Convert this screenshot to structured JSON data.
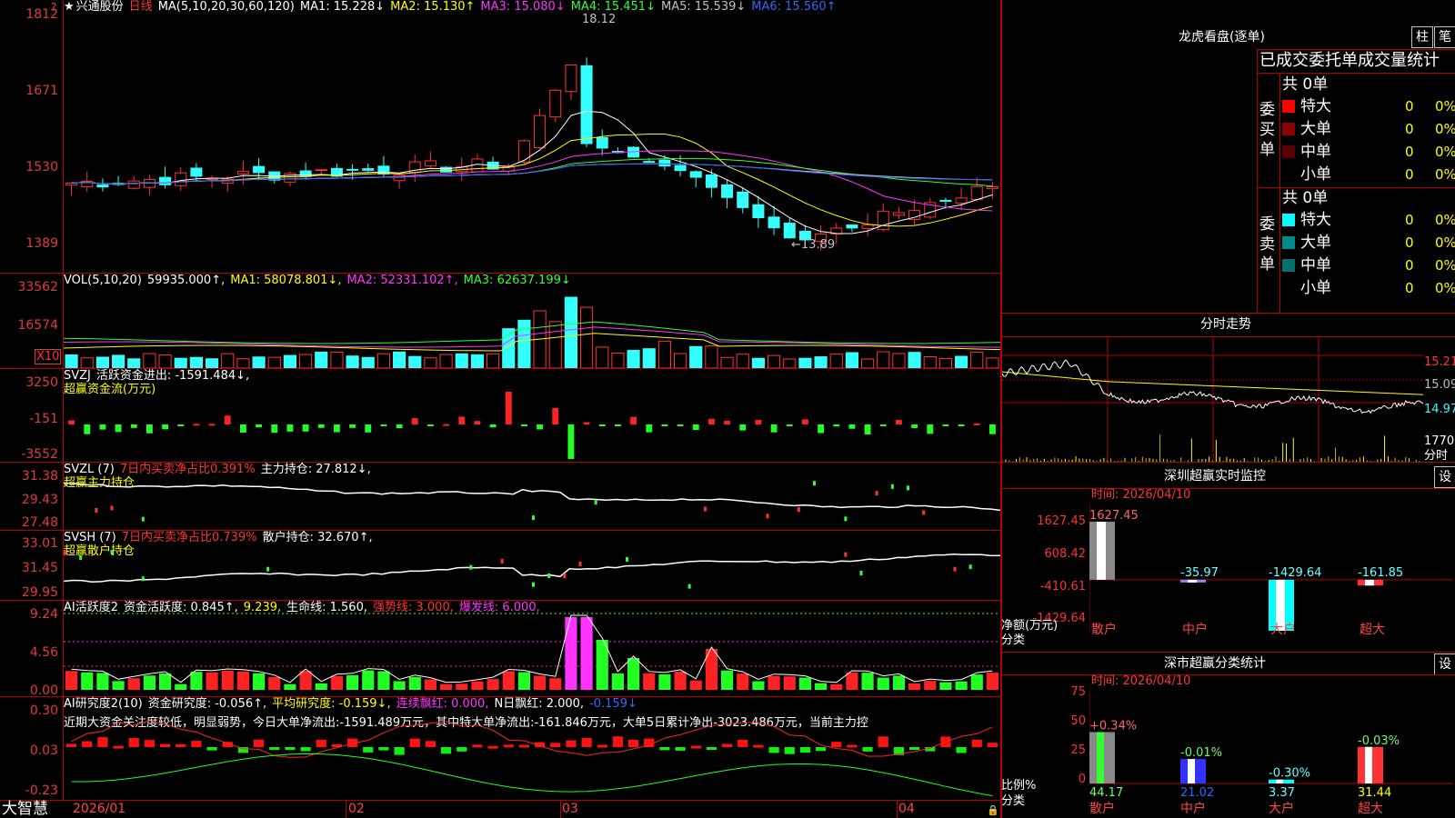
{
  "app": {
    "brand": "大智慧",
    "title_star": "★",
    "stock_name": "兴通股份",
    "period": "日线"
  },
  "price_panel": {
    "ma_label": "MA(5,10,20,30,60,120)",
    "ma_items": [
      {
        "text": "MA1: 15.228↓",
        "color": "#ffffff"
      },
      {
        "text": "MA2: 15.130↑",
        "color": "#ffff00"
      },
      {
        "text": "MA3: 15.080↓",
        "color": "#ff33ff"
      },
      {
        "text": "MA4: 15.451↓",
        "color": "#33ff33"
      },
      {
        "text": "MA5: 15.539↓",
        "color": "#c0c0c0"
      },
      {
        "text": "MA6: 15.560↑",
        "color": "#3366ff"
      }
    ],
    "axis": [
      "1812",
      "1671",
      "1530",
      "1389"
    ],
    "high_label": "18.12",
    "low_label": "13.89"
  },
  "vol_panel": {
    "label": "VOL(5,10,20)",
    "value": "59935.000↑,",
    "ma1": "MA1: 58078.801↓,",
    "ma2": "MA2: 52331.102↑,",
    "ma3": "MA3: 62637.199↓",
    "axis": [
      "33562",
      "16574"
    ],
    "scale": "X10"
  },
  "svzj_panel": {
    "label": "SVZJ",
    "text": "活跃资金进出: -1591.484↓,",
    "sub": "超赢资金流(万元)",
    "axis": [
      "3250",
      "-151",
      "-3552"
    ]
  },
  "svzl_panel": {
    "label": "SVZL (7)",
    "t1": "7日内买卖净占比0.391%",
    "t2": "主力持仓: 27.812↓,",
    "sub": "超赢主力持仓",
    "axis": [
      "31.38",
      "29.43",
      "27.48"
    ]
  },
  "svsh_panel": {
    "label": "SVSH (7)",
    "t1": "7日内买卖净占比0.739%",
    "t2": "散户持仓: 32.670↑,",
    "sub": "超赢散户持仓",
    "axis": [
      "33.01",
      "31.45",
      "29.95"
    ]
  },
  "ai1_panel": {
    "label": "AI活跃度2",
    "t1": "资金活跃度: 0.845↑,",
    "t2": "9.239,",
    "t3": "生命线: 1.560,",
    "t4": "强势线: 3.000,",
    "t5": "爆发线: 6.000,",
    "axis": [
      "9.24",
      "4.56",
      "0.00"
    ]
  },
  "ai2_panel": {
    "label": "AI研究度2(10)",
    "t1": "资金研究度: -0.056↑,",
    "t2": "平均研究度: -0.159↓,",
    "t3": "连续飘红: 0.000,",
    "t4": "N日飘红: 2.000,",
    "t5": "-0.159↓",
    "summary": "近期大资金关注度较低，明显弱势，今日大单净流出:-1591.489万元，其中特大单净流出:-161.846万元，大单5日累计净出-3023.486万元，当前主力控",
    "axis": [
      "0.30",
      "0.03",
      "-0.23"
    ]
  },
  "dates": [
    "2026/01",
    "02",
    "03",
    "04"
  ],
  "lhb": {
    "title": "龙虎看盘(逐单)",
    "btn1": "柱",
    "btn2": "笔",
    "header": "已成交委托单成交量统计",
    "buy_side": "委买单",
    "sell_side": "委卖单",
    "buy_total": "共 0单",
    "sell_total": "共 0单",
    "buy_rows": [
      {
        "label": "特大",
        "count": "0",
        "pct": "0%",
        "color": "#ff0000"
      },
      {
        "label": "大单",
        "count": "0",
        "pct": "0%",
        "color": "#8b0000"
      },
      {
        "label": "中单",
        "count": "0",
        "pct": "0%",
        "color": "#5a0000"
      },
      {
        "label": "小单",
        "count": "0",
        "pct": "0%",
        "color": ""
      }
    ],
    "sell_rows": [
      {
        "label": "特大",
        "count": "0",
        "pct": "0%",
        "color": "#00ffff"
      },
      {
        "label": "大单",
        "count": "0",
        "pct": "0%",
        "color": "#008b8b"
      },
      {
        "label": "中单",
        "count": "0",
        "pct": "0%",
        "color": "#007070"
      },
      {
        "label": "小单",
        "count": "0",
        "pct": "0%",
        "color": ""
      }
    ]
  },
  "intraday": {
    "title": "分时走势",
    "axis": [
      "15.21",
      "15.09",
      "14.97",
      "1770"
    ],
    "unit": "分时"
  },
  "sz_monitor": {
    "title": "深圳超赢实时监控",
    "btn": "设",
    "time": "时间: 2026/04/10",
    "axis": [
      "1627.45",
      "608.42",
      "-410.61",
      "-1429.64"
    ],
    "unit1": "净额(万元)",
    "unit2": "分类",
    "categories": [
      "散户",
      "中户",
      "大户",
      "超大"
    ],
    "values": [
      1627.45,
      -35.97,
      -1429.64,
      -161.85
    ],
    "value_labels": [
      "1627.45",
      "-35.97",
      "-1429.64",
      "-161.85"
    ],
    "ylim": [
      -1429.64,
      1627.45
    ]
  },
  "sz_class": {
    "title": "深市超赢分类统计",
    "btn": "设",
    "time": "时间: 2026/04/10",
    "axis": [
      "75",
      "50",
      "25",
      "0"
    ],
    "unit1": "比例%",
    "unit2": "分类",
    "categories": [
      "散户",
      "中户",
      "大户",
      "超大"
    ],
    "values": [
      44.17,
      21.02,
      3.37,
      31.44
    ],
    "value_labels": [
      "44.17",
      "21.02",
      "3.37",
      "31.44"
    ],
    "change_labels": [
      "+0.34%",
      "-0.01%",
      "-0.30%",
      "-0.03%"
    ],
    "ylim": [
      0,
      75
    ]
  }
}
